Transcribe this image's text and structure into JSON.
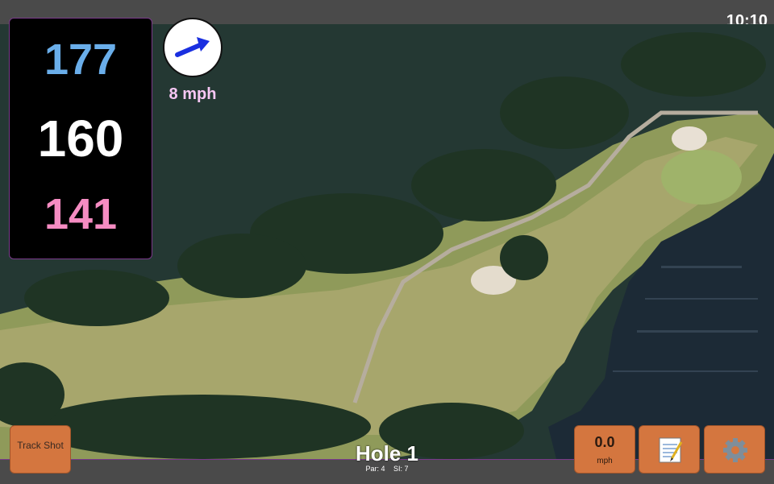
{
  "status_bar": {
    "time": "10:10"
  },
  "yardages": {
    "back": "177",
    "center": "160",
    "front": "141"
  },
  "wind": {
    "speed": "8 mph",
    "arrow_icon": "arrow-right-icon"
  },
  "hole": {
    "title": "Hole 1",
    "par": "Par: 4",
    "stroke_index": "SI: 7"
  },
  "buttons": {
    "track_shot": "Track Shot",
    "speed_value": "0.0",
    "speed_unit": "mph",
    "notes_icon": "notepad-icon",
    "settings_icon": "gear-icon"
  },
  "colors": {
    "back_yardage": "#6aaeea",
    "center_yardage": "#ffffff",
    "front_yardage": "#f58cc2",
    "button": "#d4763f",
    "wind_text": "#f7c7f4"
  }
}
